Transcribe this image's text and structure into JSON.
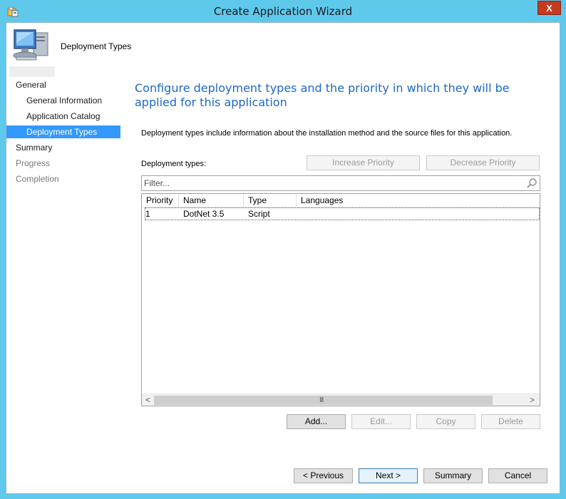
{
  "window": {
    "title": "Create Application Wizard",
    "close_label": "X"
  },
  "header": {
    "title": "Deployment Types",
    "icon": "computer-icon"
  },
  "nav": {
    "items": [
      {
        "label": "General",
        "level": "top",
        "state": "normal"
      },
      {
        "label": "General Information",
        "level": "sub",
        "state": "normal"
      },
      {
        "label": "Application Catalog",
        "level": "sub",
        "state": "normal"
      },
      {
        "label": "Deployment Types",
        "level": "sub",
        "state": "selected"
      },
      {
        "label": "Summary",
        "level": "top",
        "state": "normal"
      },
      {
        "label": "Progress",
        "level": "top",
        "state": "disabled"
      },
      {
        "label": "Completion",
        "level": "top",
        "state": "disabled"
      }
    ]
  },
  "main": {
    "heading": "Configure deployment types and the priority in which they will be applied for this application",
    "description": "Deployment types include information about the installation method and the source files for this application.",
    "list_label": "Deployment types:",
    "increase_priority": "Increase Priority",
    "decrease_priority": "Decrease Priority",
    "filter_placeholder": "Filter...",
    "columns": [
      "Priority",
      "Name",
      "Type",
      "Languages"
    ],
    "rows": [
      {
        "priority": "1",
        "name": "DotNet 3.5",
        "type": "Script",
        "languages": ""
      }
    ],
    "scroll_left": "<",
    "scroll_right": ">",
    "scroll_grip": "III",
    "add": "Add...",
    "edit": "Edit...",
    "copy": "Copy",
    "delete": "Delete"
  },
  "footer": {
    "previous": "< Previous",
    "next": "Next >",
    "summary": "Summary",
    "cancel": "Cancel"
  },
  "colors": {
    "frame": "#5fc9ec",
    "heading": "#1e68c2",
    "selection": "#3399ff",
    "close": "#c6391f"
  }
}
